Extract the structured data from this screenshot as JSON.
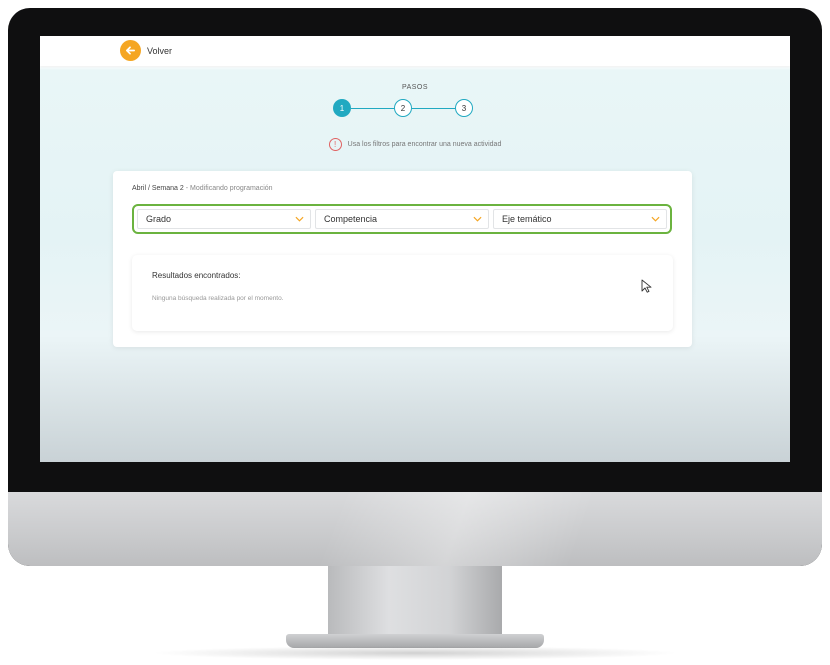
{
  "header": {
    "back_label": "Volver",
    "back_icon": "arrow-left-icon",
    "accent": "#f5a623"
  },
  "steps": {
    "title": "PASOS",
    "items": [
      "1",
      "2",
      "3"
    ],
    "active": 1,
    "color": "#21a9c1"
  },
  "hint": {
    "icon": "!",
    "text": "Usa los filtros para encontrar una nueva actividad"
  },
  "breadcrumb": {
    "month": "Abril",
    "separator": "/",
    "week": "Semana 2",
    "dash": "-",
    "context": "Modificando programación"
  },
  "filters": {
    "border_color": "#6bb33f",
    "grado": "Grado",
    "competencia": "Competencia",
    "eje": "Eje temático",
    "chevron_color": "#f5a623"
  },
  "results": {
    "title": "Resultados encontrados:",
    "empty": "Ninguna búsqueda realizada por el momento."
  }
}
